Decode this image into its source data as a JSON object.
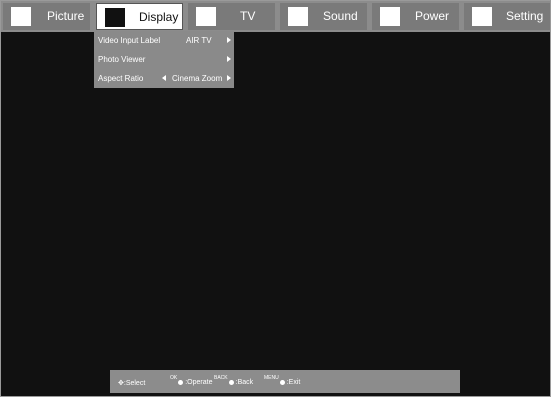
{
  "top_tabs": [
    {
      "label": "Picture",
      "icon": "picture-icon",
      "active": false
    },
    {
      "label": "Display",
      "icon": "display-icon",
      "active": true
    },
    {
      "label": "TV",
      "icon": "tv-icon",
      "active": false
    },
    {
      "label": "Sound",
      "icon": "music-note-icon",
      "active": false
    },
    {
      "label": "Power",
      "icon": "power-plug-icon",
      "active": false
    },
    {
      "label": "Setting",
      "icon": "wrench-icon",
      "active": false
    }
  ],
  "display_menu": {
    "items": [
      {
        "label": "Video Input Label",
        "value": "AIR TV"
      },
      {
        "label": "Photo Viewer",
        "value": ""
      },
      {
        "label": "Aspect Ratio",
        "value": "Cinema Zoom"
      }
    ]
  },
  "hints": {
    "select": ":Select",
    "ok_key": "OK",
    "operate": ":Operate",
    "back_key": "BACK",
    "back": ":Back",
    "menu_key": "MENU",
    "exit": ":Exit"
  },
  "colors": {
    "bar": "#8c8c8c",
    "tab": "#7a7a7a",
    "active_tab": "#ffffff",
    "background": "#111111"
  }
}
